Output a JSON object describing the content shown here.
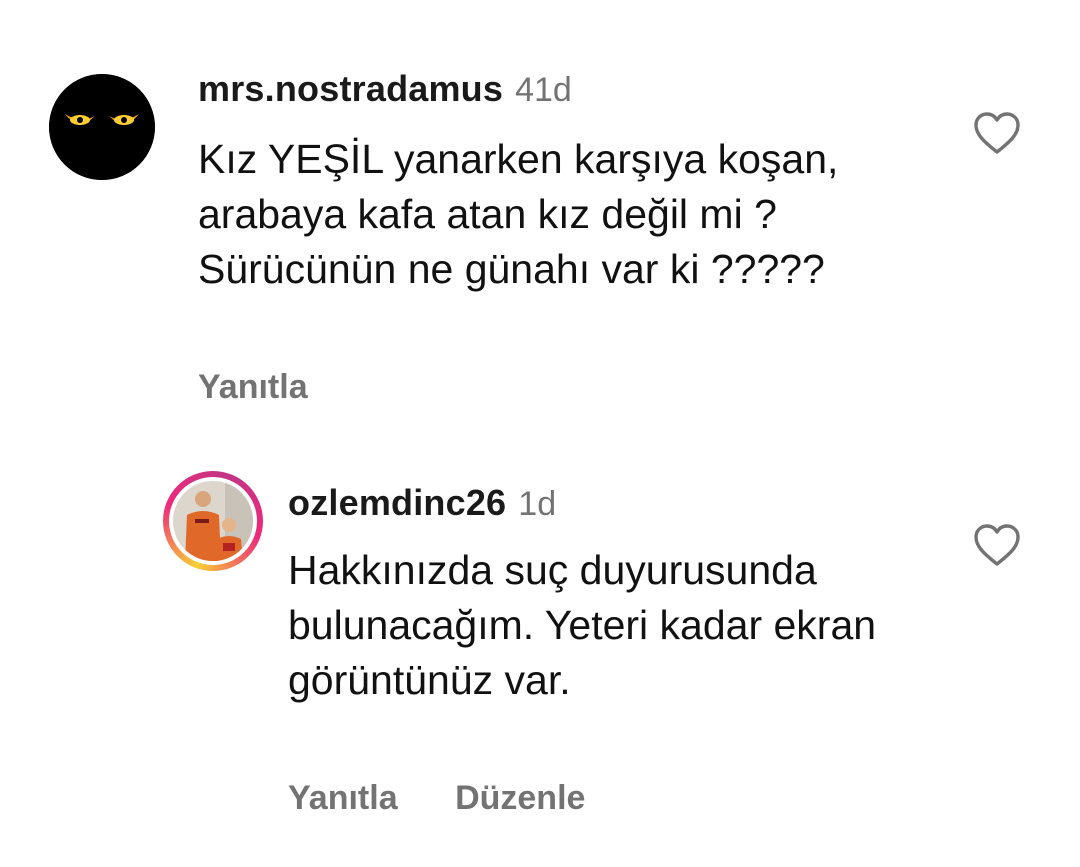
{
  "comments": [
    {
      "username": "mrs.nostradamus",
      "time": "41d",
      "text": "Kız YEŞİL yanarken karşıya koşan, arabaya kafa atan kız değil mi ? Sürücünün ne günahı var ki ?????",
      "actions": [
        "Yanıtla"
      ],
      "avatar_icon": "dark-eyes-avatar",
      "liked": false
    },
    {
      "username": "ozlemdinc26",
      "time": "1d",
      "text": "Hakkınızda suç duyurusunda bulunacağım. Yeteri kadar ekran görüntünüz var.",
      "actions": [
        "Yanıtla",
        "Düzenle"
      ],
      "avatar_icon": "photo-avatar-with-story-ring",
      "liked": false
    }
  ],
  "colors": {
    "muted": "#737373",
    "text": "#111111",
    "story_ring": [
      "#f9ce34",
      "#ee2a7b",
      "#c13584"
    ]
  }
}
